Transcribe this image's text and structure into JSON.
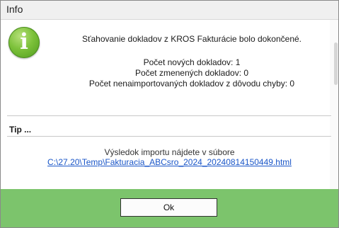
{
  "window": {
    "title": "Info"
  },
  "message": {
    "heading": "Sťahovanie dokladov z KROS Fakturácie bolo dokončené.",
    "new_docs": "Počet nových dokladov: 1",
    "changed_docs": "Počet zmenených dokladov: 0",
    "not_imported": "Počet nenaimportovaných dokladov z dôvodu chyby: 0"
  },
  "tip": {
    "title": "Tip ...",
    "result_text": "Výsledok importu nájdete v súbore",
    "result_link": "C:\\27.20\\Temp\\Fakturacia_ABCsro_2024_20240814150449.html"
  },
  "footer": {
    "ok_label": "Ok"
  },
  "colors": {
    "footer_bg": "#7cc46c",
    "icon": "#6ab52f",
    "link": "#1a56c8"
  },
  "icons": {
    "info": "info-icon"
  }
}
